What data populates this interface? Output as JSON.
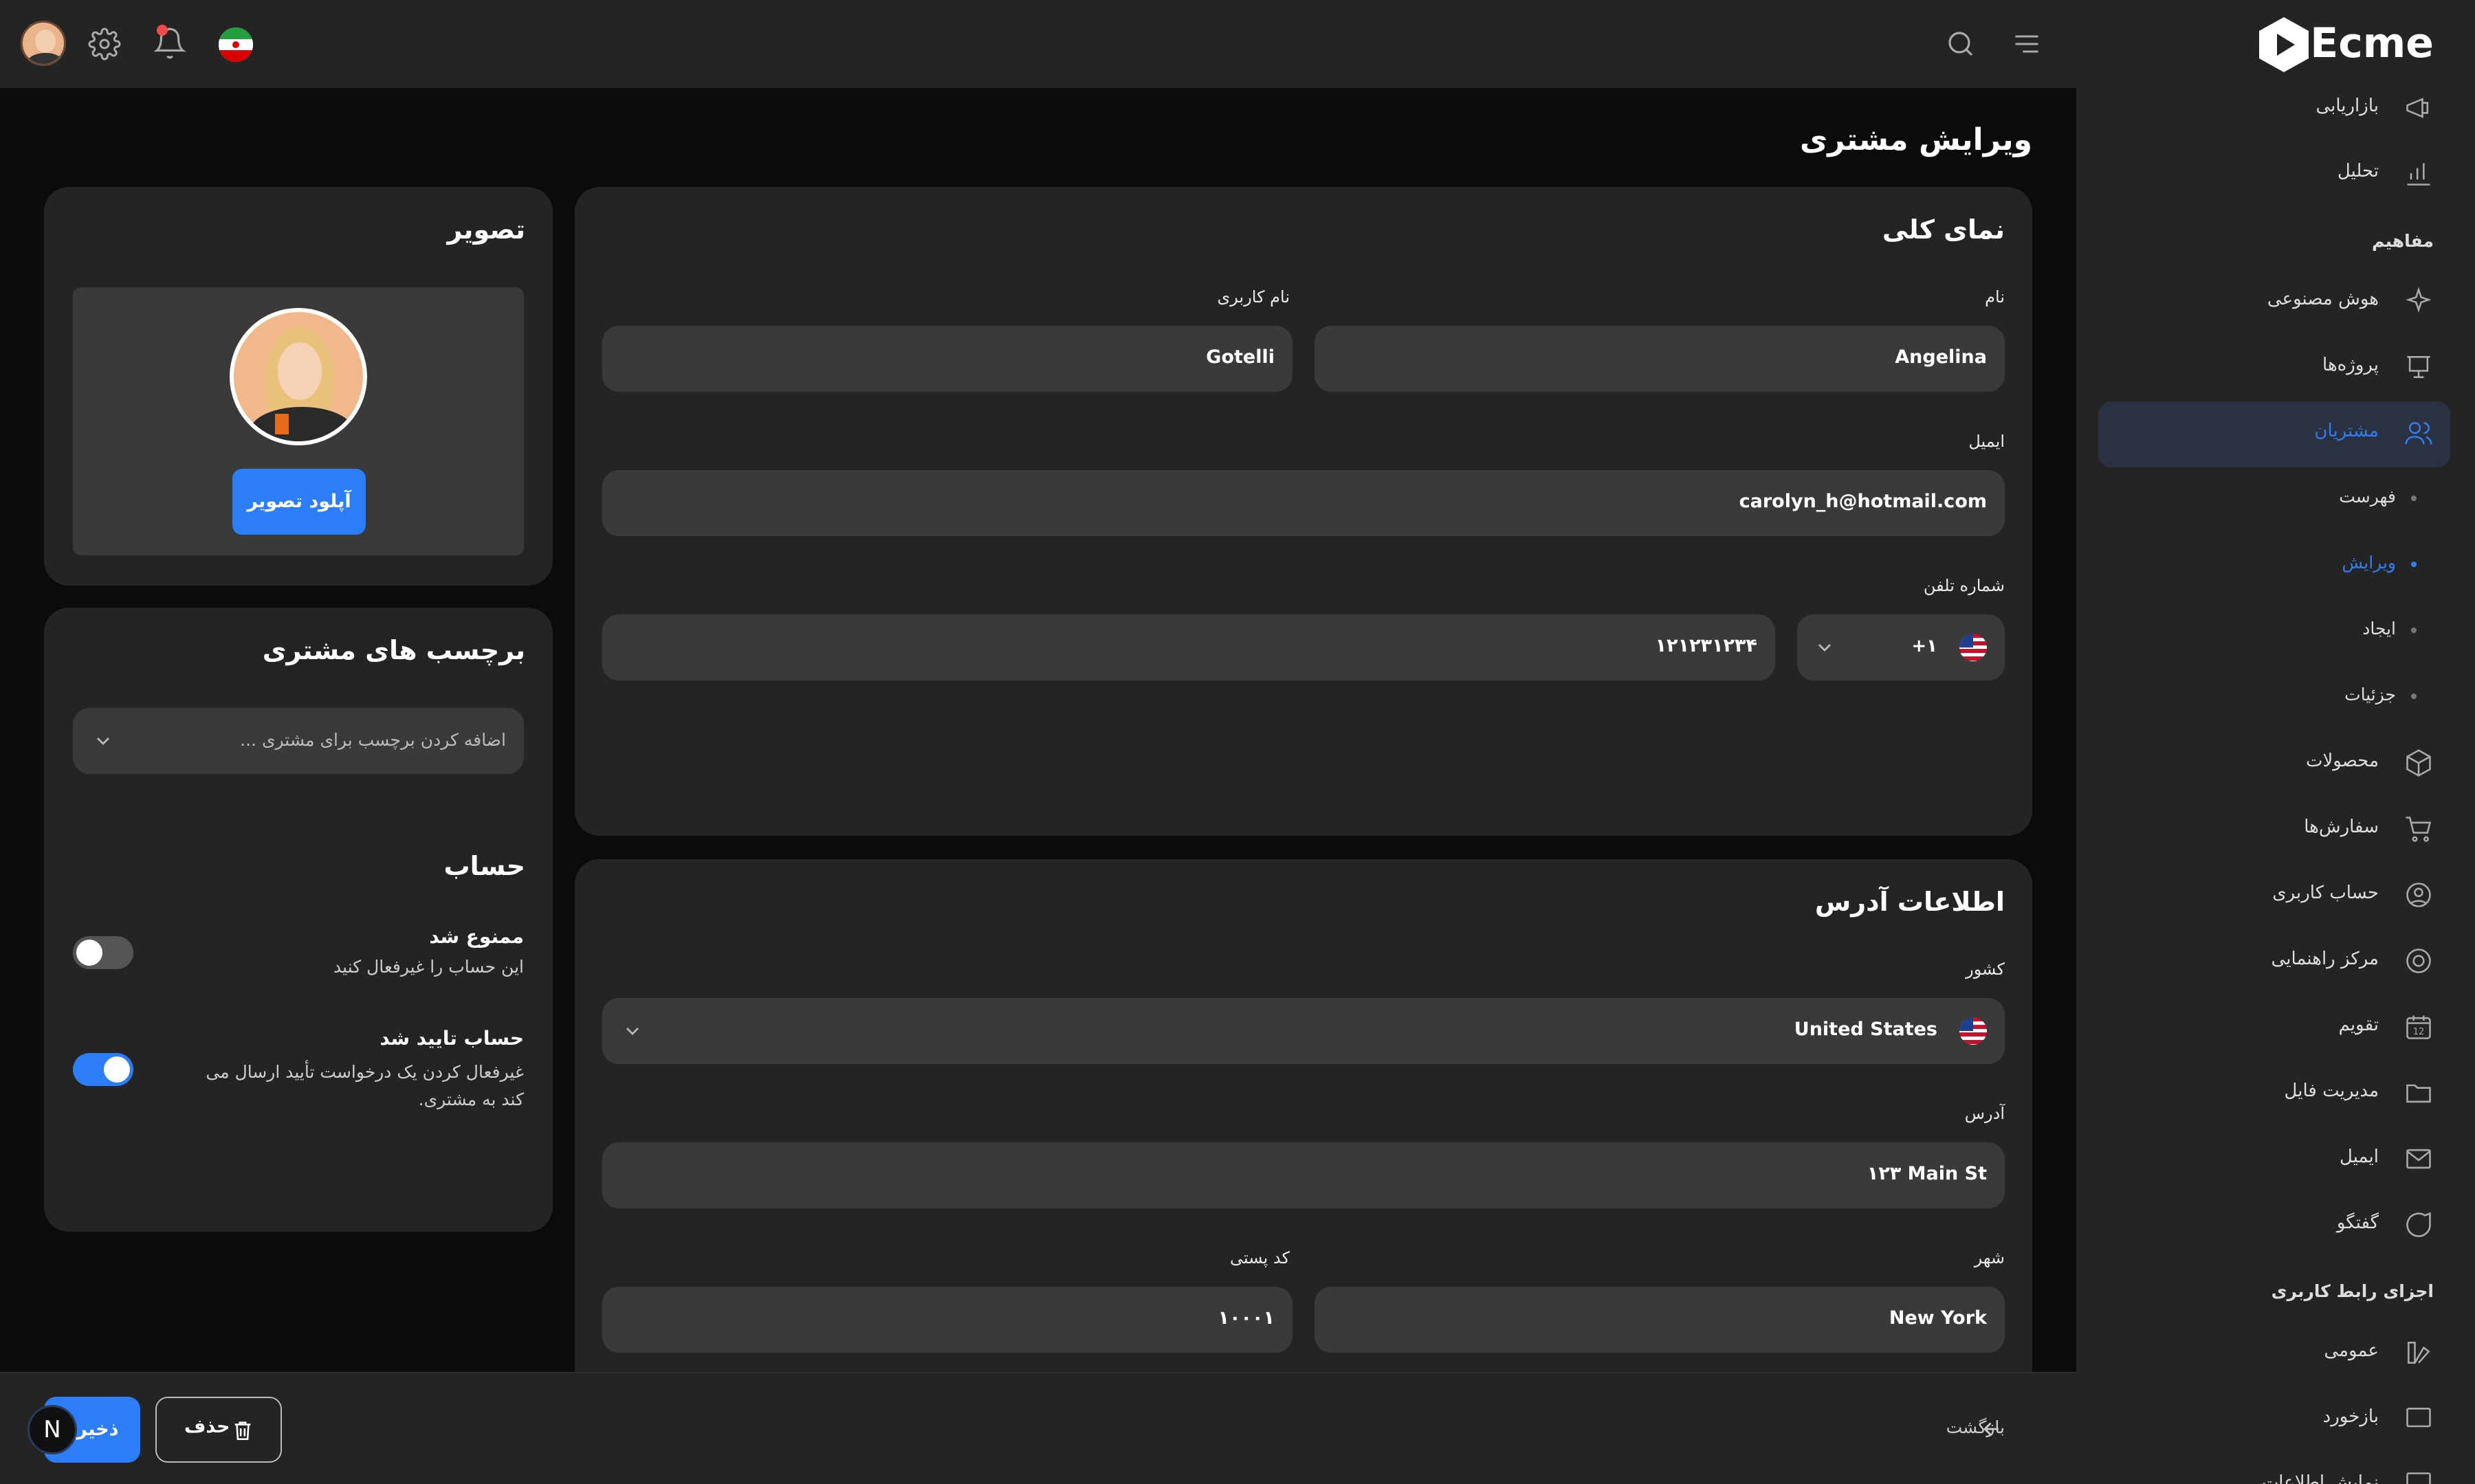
{
  "brand": {
    "name": "Ecme",
    "accent": "#2d7df6"
  },
  "sidebar": {
    "items": [
      {
        "label": "بازاریابی",
        "icon": "megaphone-icon"
      },
      {
        "label": "تحلیل",
        "icon": "chart-bar-icon"
      },
      {
        "section": "مفاهیم"
      },
      {
        "label": "هوش مصنوعی",
        "icon": "sparkle-icon"
      },
      {
        "label": "پروژه‌ها",
        "icon": "presentation-icon"
      },
      {
        "label": "مشتریان",
        "icon": "users-icon"
      },
      {
        "label": "فهرست"
      },
      {
        "label": "ویرایش"
      },
      {
        "label": "ایجاد"
      },
      {
        "label": "جزئیات"
      },
      {
        "label": "محصولات",
        "icon": "box-icon"
      },
      {
        "label": "سفارش‌ها",
        "icon": "cart-icon"
      },
      {
        "label": "حساب کاربری",
        "icon": "user-circle-icon"
      },
      {
        "label": "مرکز راهنمایی",
        "icon": "help-icon"
      },
      {
        "label": "تقویم",
        "icon": "calendar-icon",
        "day": "12"
      },
      {
        "label": "مدیریت فایل",
        "icon": "folder-icon"
      },
      {
        "label": "ایمیل",
        "icon": "mail-icon"
      },
      {
        "label": "گفتگو",
        "icon": "chat-icon"
      },
      {
        "section": "اجزای رابط کاربری"
      },
      {
        "label": "عمومی",
        "icon": "swatch-icon"
      },
      {
        "label": "بازخورد",
        "icon": "feedback-icon"
      },
      {
        "label": "نمایش اطلاعات",
        "icon": "data-icon"
      }
    ]
  },
  "page": {
    "title": "ویرایش مشتری"
  },
  "overview": {
    "title": "نمای کلی",
    "first_name_label": "نام",
    "first_name": "Angelina",
    "username_label": "نام کاربری",
    "username": "Gotelli",
    "email_label": "ایمیل",
    "email": "carolyn_h@hotmail.com",
    "phone_label": "شماره تلفن",
    "dial_code": "+۱",
    "phone": "۱۲۱۲۳۱۲۳۴"
  },
  "address": {
    "title": "اطلاعات آدرس",
    "country_label": "کشور",
    "country": "United States",
    "address_label": "آدرس",
    "address": "۱۲۳ Main St",
    "city_label": "شهر",
    "city": "New York",
    "postal_label": "کد پستی",
    "postal": "۱۰۰۰۱"
  },
  "image_card": {
    "title": "تصویر",
    "upload_label": "آپلود تصویر"
  },
  "tags_card": {
    "title": "برچسب های مشتری",
    "placeholder": "اضافه کردن برچسب برای مشتری ..."
  },
  "account_card": {
    "title": "حساب",
    "banned_title": "ممنوع شد",
    "banned_desc": "این حساب را غیرفعال کنید",
    "banned_on": false,
    "verified_title": "حساب تایید شد",
    "verified_desc": "غیرفعال کردن یک درخواست تأیید ارسال می کند به مشتری.",
    "verified_on": true
  },
  "footer": {
    "back_label": "بازگشت",
    "delete_label": "حذف",
    "save_label": "ذخیره",
    "n_badge": "N"
  }
}
